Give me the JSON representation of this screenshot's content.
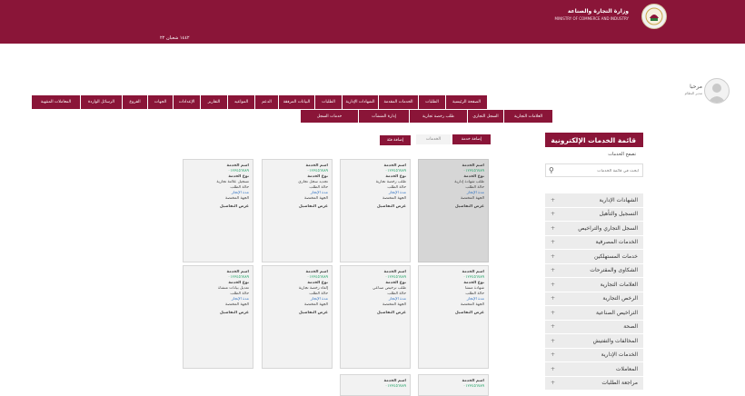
{
  "header": {
    "ministry_ar": "وزارة التجارة والصناعة",
    "ministry_en": "MINISTRY OF COMMERCE AND INDUSTRY",
    "date": "١٤٤٢ شعبان ٢٢"
  },
  "profile": {
    "name": "مرحبا",
    "role": "مدير النظام"
  },
  "nav": [
    {
      "label": "الصفحة الرئيسية",
      "w": 46
    },
    {
      "label": "الطلبات",
      "w": 30
    },
    {
      "label": "الخدمات المقدمة",
      "w": 44
    },
    {
      "label": "الشهادات الإدارية",
      "w": 40
    },
    {
      "label": "الطلبات",
      "w": 30
    },
    {
      "label": "البيانات المرفقة",
      "w": 40
    },
    {
      "label": "الدعم",
      "w": 26
    },
    {
      "label": "المواعيد",
      "w": 30
    },
    {
      "label": "التقارير",
      "w": 30
    },
    {
      "label": "الإعدادات",
      "w": 30
    },
    {
      "label": "الجهات",
      "w": 28
    },
    {
      "label": "الفروع",
      "w": 28
    },
    {
      "label": "الرسائل الواردة",
      "w": 46
    },
    {
      "label": "المعاملات المنتهية",
      "w": 54
    }
  ],
  "subnav": [
    {
      "label": "العلامات التجارية",
      "w": 54
    },
    {
      "label": "السجل التجاري",
      "w": 40
    },
    {
      "label": "طلب رخصة تجارية",
      "w": 64
    },
    {
      "label": "إدارة المنشآت",
      "w": 56
    },
    {
      "label": "خدمات السجل",
      "w": 64
    }
  ],
  "actions": {
    "add": "إضافة خدمة",
    "label": "الخدمات",
    "add2": "إضافة فئة"
  },
  "sidebar": {
    "title": "قائمة الخدمات الإلكترونية",
    "subtitle": "تصفح الخدمات",
    "search_placeholder": "ابحث في قائمة الخدمات",
    "categories": [
      "الشهادات الإدارية",
      "التسجيل والتأهيل",
      "السجل التجاري والتراخيص",
      "الخدمات المصرفية",
      "خدمات المستهلكين",
      "الشكاوى والمقترحات",
      "العلامات التجارية",
      "الرخص التجارية",
      "التراخيص الصناعية",
      "الصحة",
      "المخالفات والتفتيش",
      "الخدمات الإدارية",
      "المعاملات",
      "مراجعة الطلبات"
    ]
  },
  "cards": [
    {
      "lines": [
        "اسم الخدمة",
        "٠١٢٣٤٥٦٧٨٩",
        "نوع الخدمة",
        "طلب شهادة إدارية",
        "حالة الطلب",
        "مدة الإنجاز",
        "الجهة المختصة",
        "عرض التفاصيل"
      ]
    },
    {
      "lines": [
        "اسم الخدمة",
        "٠١٢٣٤٥٦٧٨٩",
        "نوع الخدمة",
        "طلب رخصة تجارية",
        "حالة الطلب",
        "مدة الإنجاز",
        "الجهة المختصة",
        "عرض التفاصيل"
      ]
    },
    {
      "lines": [
        "اسم الخدمة",
        "٠١٢٣٤٥٦٧٨٩",
        "نوع الخدمة",
        "تجديد سجل تجاري",
        "حالة الطلب",
        "مدة الإنجاز",
        "الجهة المختصة",
        "عرض التفاصيل"
      ]
    },
    {
      "lines": [
        "اسم الخدمة",
        "٠١٢٣٤٥٦٧٨٩",
        "نوع الخدمة",
        "تسجيل علامة تجارية",
        "حالة الطلب",
        "مدة الإنجاز",
        "الجهة المختصة",
        "عرض التفاصيل"
      ]
    },
    {
      "lines": [
        "اسم الخدمة",
        "٠١٢٣٤٥٦٧٨٩",
        "نوع الخدمة",
        "شهادة منشأ",
        "حالة الطلب",
        "مدة الإنجاز",
        "الجهة المختصة",
        "عرض التفاصيل"
      ]
    },
    {
      "lines": [
        "اسم الخدمة",
        "٠١٢٣٤٥٦٧٨٩",
        "نوع الخدمة",
        "طلب ترخيص صناعي",
        "حالة الطلب",
        "مدة الإنجاز",
        "الجهة المختصة",
        "عرض التفاصيل"
      ]
    },
    {
      "lines": [
        "اسم الخدمة",
        "٠١٢٣٤٥٦٧٨٩",
        "نوع الخدمة",
        "إلغاء رخصة تجارية",
        "حالة الطلب",
        "مدة الإنجاز",
        "الجهة المختصة",
        "عرض التفاصيل"
      ]
    },
    {
      "lines": [
        "اسم الخدمة",
        "٠١٢٣٤٥٦٧٨٩",
        "نوع الخدمة",
        "تعديل بيانات منشأة",
        "حالة الطلب",
        "مدة الإنجاز",
        "الجهة المختصة",
        "عرض التفاصيل"
      ]
    },
    {
      "lines": [
        "اسم الخدمة",
        "٠١٢٣٤٥٦٧٨٩"
      ]
    },
    {
      "lines": [
        "اسم الخدمة",
        "٠١٢٣٤٥٦٧٨٩"
      ]
    }
  ]
}
